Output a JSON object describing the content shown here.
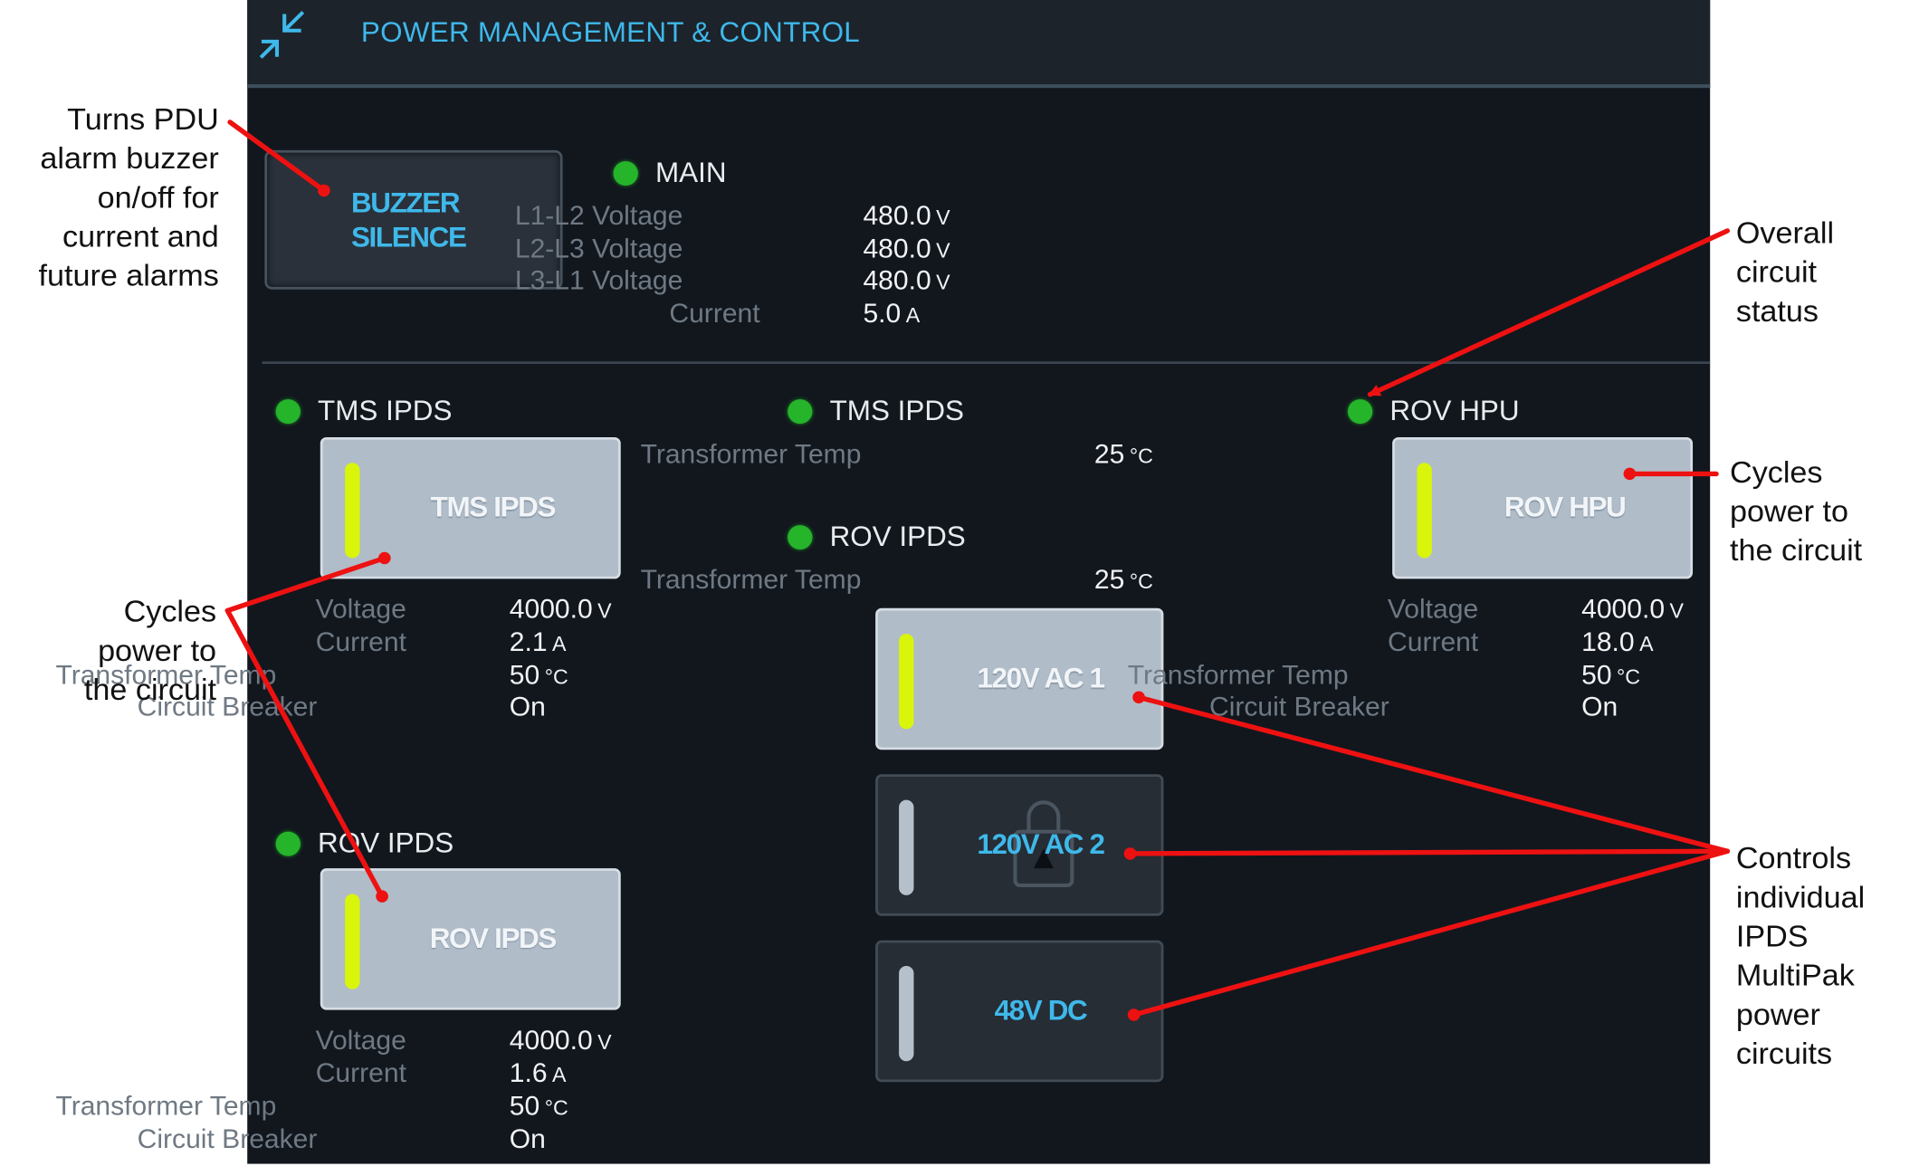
{
  "header": {
    "title": "POWER MANAGEMENT & CONTROL",
    "icon": "collapse-arrows-icon"
  },
  "buzzer": {
    "line1": "BUZZER",
    "line2": "SILENCE"
  },
  "main": {
    "title": "MAIN",
    "rows": [
      {
        "label": "L1-L2 Voltage",
        "value": "480.0",
        "unit": "V"
      },
      {
        "label": "L2-L3 Voltage",
        "value": "480.0",
        "unit": "V"
      },
      {
        "label": "L3-L1 Voltage",
        "value": "480.0",
        "unit": "V"
      },
      {
        "label": "Current",
        "value": "5.0",
        "unit": "A"
      }
    ]
  },
  "tms_left": {
    "title": "TMS IPDS",
    "button_label": "TMS IPDS",
    "rows": [
      {
        "label": "Voltage",
        "value": "4000.0",
        "unit": "V"
      },
      {
        "label": "Current",
        "value": "2.1",
        "unit": "A"
      },
      {
        "label": "Transformer Temp",
        "value": "50",
        "unit": "°C"
      },
      {
        "label": "Circuit Breaker",
        "value": "On",
        "unit": ""
      }
    ]
  },
  "rov_left": {
    "title": "ROV IPDS",
    "button_label": "ROV IPDS",
    "rows": [
      {
        "label": "Voltage",
        "value": "4000.0",
        "unit": "V"
      },
      {
        "label": "Current",
        "value": "1.6",
        "unit": "A"
      },
      {
        "label": "Transformer Temp",
        "value": "50",
        "unit": "°C"
      },
      {
        "label": "Circuit Breaker",
        "value": "On",
        "unit": ""
      }
    ]
  },
  "tms_mid": {
    "title": "TMS IPDS",
    "rows": [
      {
        "label": "Transformer Temp",
        "value": "25",
        "unit": "°C"
      }
    ]
  },
  "rov_mid": {
    "title": "ROV IPDS",
    "rows": [
      {
        "label": "Transformer Temp",
        "value": "25",
        "unit": "°C"
      }
    ]
  },
  "multipak": [
    {
      "label": "120V AC 1",
      "state": "on"
    },
    {
      "label": "120V AC 2",
      "state": "locked"
    },
    {
      "label": "48V DC",
      "state": "off"
    }
  ],
  "rov_hpu": {
    "title": "ROV HPU",
    "button_label": "ROV HPU",
    "rows": [
      {
        "label": "Voltage",
        "value": "4000.0",
        "unit": "V"
      },
      {
        "label": "Current",
        "value": "18.0",
        "unit": "A"
      },
      {
        "label": "Transformer Temp",
        "value": "50",
        "unit": "°C"
      },
      {
        "label": "Circuit Breaker",
        "value": "On",
        "unit": ""
      }
    ]
  },
  "annotations": {
    "buzzer": [
      "Turns PDU",
      "alarm buzzer",
      "on/off for",
      "current and",
      "future alarms"
    ],
    "cycles_left": [
      "Cycles",
      "power to",
      "the circuit"
    ],
    "overall": [
      "Overall",
      "circuit",
      "status"
    ],
    "cycles_right": [
      "Cycles",
      "power to",
      "the circuit"
    ],
    "controls": [
      "Controls",
      "individual",
      "IPDS",
      "MultiPak",
      "power",
      "circuits"
    ]
  },
  "colors": {
    "panel_bg": "#12171e",
    "accent_blue": "#3fb8ea",
    "status_green": "#25b42a",
    "indicator_on": "#d9f50a",
    "annotation_red": "#ee1111"
  }
}
